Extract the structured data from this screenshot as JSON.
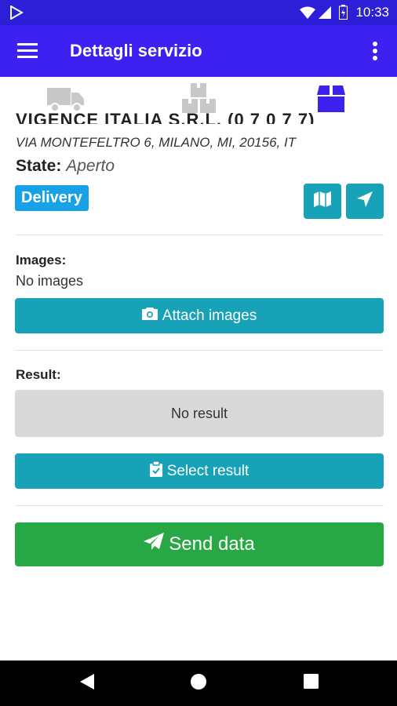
{
  "status_bar": {
    "time": "10:33"
  },
  "app_bar": {
    "title": "Dettagli servizio"
  },
  "tabs": [
    {
      "icon": "truck-icon",
      "active": false
    },
    {
      "icon": "boxes-icon",
      "active": false
    },
    {
      "icon": "box-icon",
      "active": true
    }
  ],
  "service": {
    "company_partial": "VIGENCE ITALIA S.R.L. (0 7 0 7 7)",
    "address": "VIA MONTEFELTRO 6, MILANO, MI, 20156, IT",
    "state_label": "State:",
    "state_value": "Aperto",
    "type_badge": "Delivery"
  },
  "images": {
    "label": "Images:",
    "empty_text": "No images",
    "attach_button": "Attach images"
  },
  "result": {
    "label": "Result:",
    "current": "No result",
    "select_button": "Select result"
  },
  "send_button": "Send data",
  "colors": {
    "primary": "#3c21f0",
    "info": "#17a2b8",
    "badge": "#17a2e8",
    "success": "#28a745",
    "muted": "#d9d9d9"
  }
}
